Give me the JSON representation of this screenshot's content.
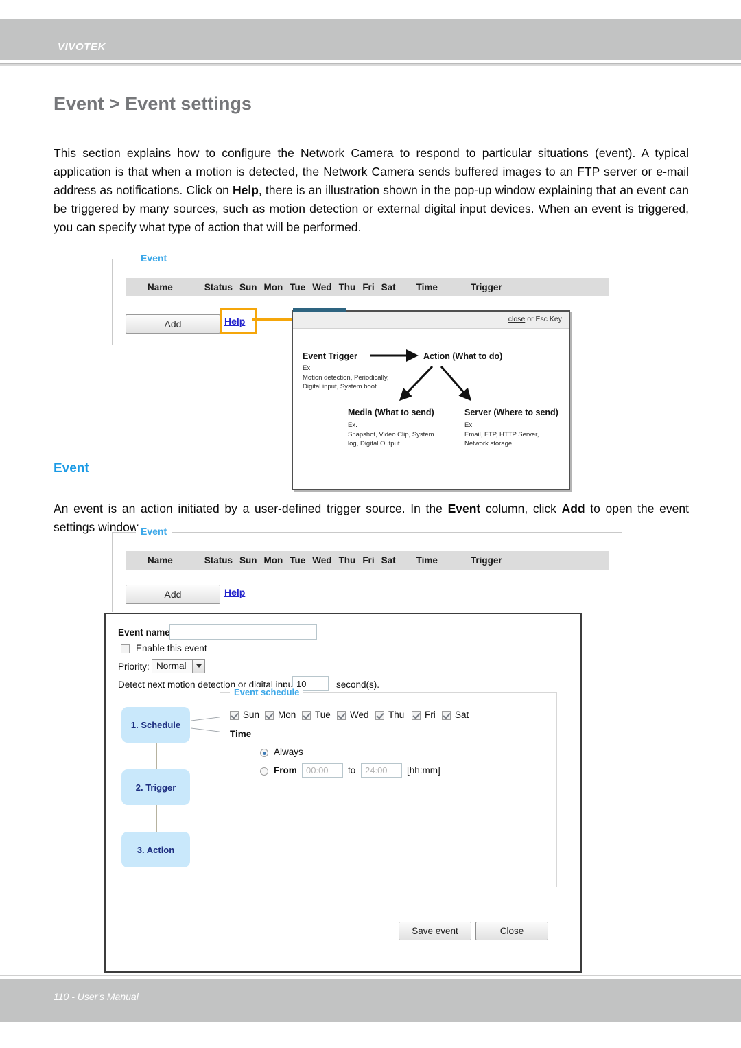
{
  "header": {
    "brand": "VIVOTEK"
  },
  "title": "Event > Event settings",
  "intro_paragraph": {
    "part1": "This section explains how to configure the Network Camera to respond to particular situations (event). A typical application is that when a motion is detected, the Network Camera sends buffered images to an FTP server or e-mail address as notifications. Click on ",
    "bold1": "Help",
    "part2": ", there is an illustration shown in the pop-up window explaining that an event can be triggered by many sources, such as motion detection or external digital input devices. When an event is triggered, you can specify what type of action that will be performed."
  },
  "section_heading": "Event",
  "event_paragraph": {
    "part1": "An event is an action initiated by a user-defined trigger source. In the ",
    "bold1": "Event",
    "part2": " column, click ",
    "bold2": "Add",
    "part3": " to open the event settings window."
  },
  "event_panel": {
    "legend": "Event",
    "columns": [
      "Name",
      "Status",
      "Sun",
      "Mon",
      "Tue",
      "Wed",
      "Thu",
      "Fri",
      "Sat",
      "Time",
      "Trigger"
    ],
    "add_label": "Add",
    "help_label": "Help"
  },
  "help_popup": {
    "close_link": "close",
    "close_suffix": " or Esc Key",
    "trigger_title": "Event Trigger",
    "trigger_examples": "Ex.\nMotion detection, Periodically,\nDigital input, System boot",
    "action_title": "Action (What to do)",
    "media_title": "Media (What to send)",
    "media_examples": "Ex.\nSnapshot, Video Clip, System\nlog, Digital Output",
    "server_title": "Server (Where to send)",
    "server_examples": "Ex.\nEmail, FTP, HTTP Server,\nNetwork storage"
  },
  "dialog": {
    "event_name_label": "Event name:",
    "event_name_value": "",
    "enable_label": "Enable this event",
    "enable_checked": false,
    "priority_label": "Priority:",
    "priority_value": "Normal",
    "detect_prefix": "Detect next motion detection or digital input after",
    "detect_value": "10",
    "detect_suffix": "second(s).",
    "steps": [
      {
        "label": "1. Schedule"
      },
      {
        "label": "2. Trigger"
      },
      {
        "label": "3. Action"
      }
    ],
    "schedule": {
      "legend": "Event schedule",
      "days": [
        {
          "label": "Sun",
          "checked": true
        },
        {
          "label": "Mon",
          "checked": true
        },
        {
          "label": "Tue",
          "checked": true
        },
        {
          "label": "Wed",
          "checked": true
        },
        {
          "label": "Thu",
          "checked": true
        },
        {
          "label": "Fri",
          "checked": true
        },
        {
          "label": "Sat",
          "checked": true
        }
      ],
      "time_label": "Time",
      "always_label": "Always",
      "always_selected": true,
      "from_label": "From",
      "from_value": "00:00",
      "to_label": "to",
      "to_value": "24:00",
      "format_hint": "[hh:mm]"
    },
    "save_label": "Save event",
    "close_label": "Close"
  },
  "footer": {
    "text": "110 - User's Manual"
  },
  "colors": {
    "bar_gray": "#c2c3c3",
    "title_gray": "#76777a",
    "accent_blue": "#3ba7e8",
    "link_blue": "#2222cc",
    "highlight_orange": "#f5a60a",
    "step_blue": "#c9e8fb",
    "step_text": "#1d2e80"
  }
}
